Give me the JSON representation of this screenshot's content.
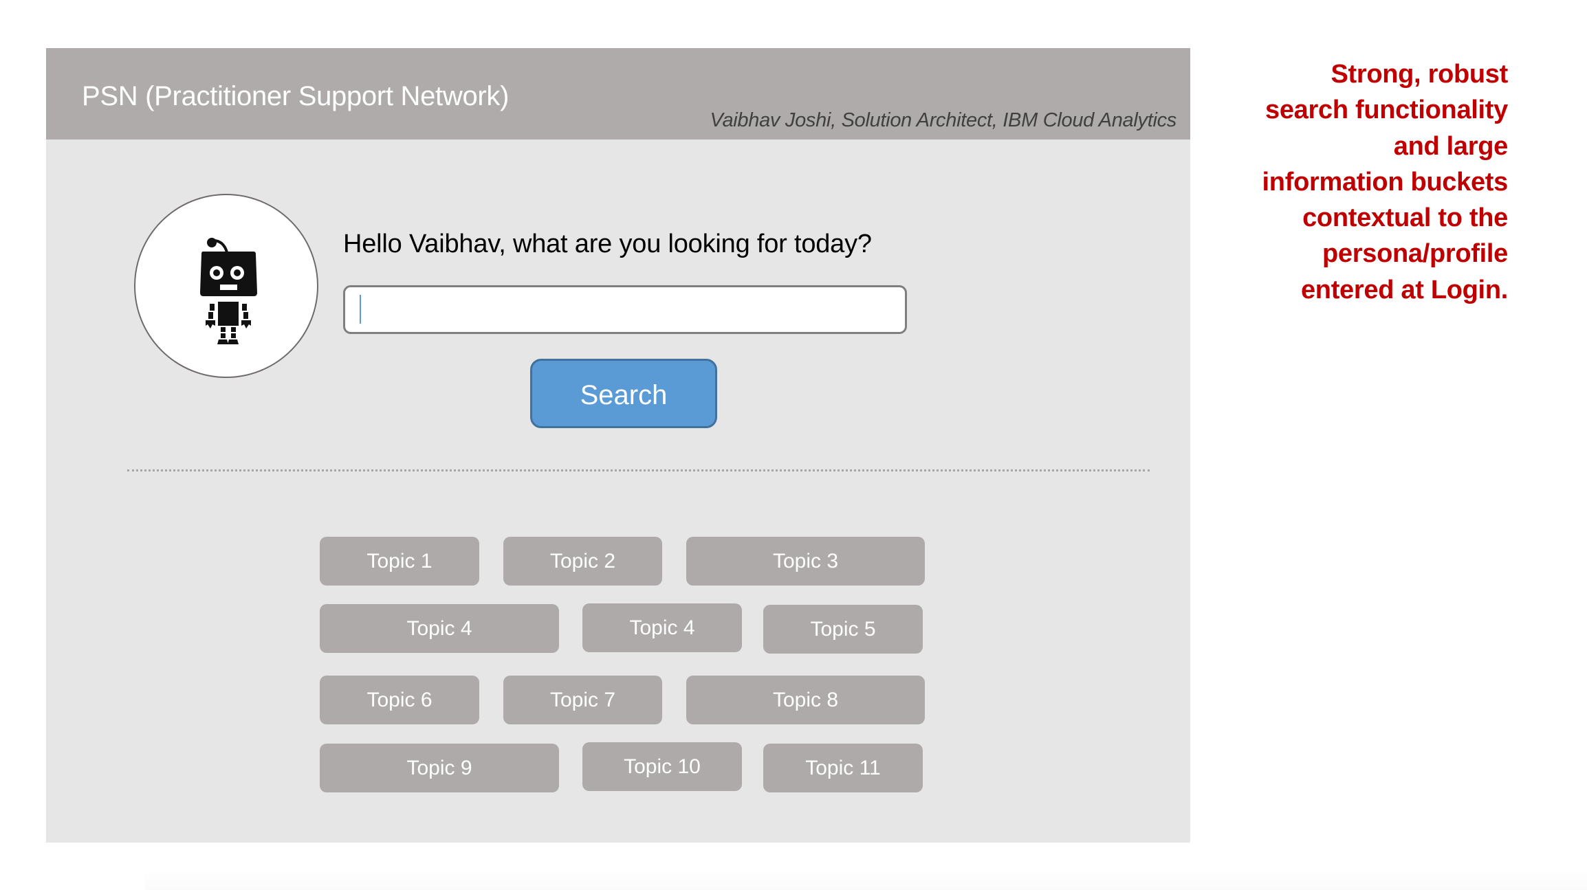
{
  "header": {
    "title": "PSN (Practitioner Support Network)",
    "subtitle": "Vaibhav Joshi, Solution Architect, IBM Cloud Analytics"
  },
  "avatar": {
    "icon": "robot-icon"
  },
  "search": {
    "greeting": "Hello Vaibhav, what are you looking for today?",
    "value": "",
    "placeholder": "",
    "button_label": "Search"
  },
  "topics": [
    {
      "label": "Topic 1"
    },
    {
      "label": "Topic 2"
    },
    {
      "label": "Topic 3"
    },
    {
      "label": "Topic 4"
    },
    {
      "label": "Topic 4"
    },
    {
      "label": "Topic 5"
    },
    {
      "label": "Topic 6"
    },
    {
      "label": "Topic 7"
    },
    {
      "label": "Topic 8"
    },
    {
      "label": "Topic 9"
    },
    {
      "label": "Topic 10"
    },
    {
      "label": "Topic 11"
    }
  ],
  "annotation": {
    "lines": [
      "Strong, robust",
      "search functionality",
      "and large",
      "information buckets",
      "contextual to the",
      "persona/profile",
      "entered at Login."
    ]
  },
  "colors": {
    "header_bg": "#afabaa",
    "panel_bg": "#e6e6e6",
    "accent": "#5b9bd5",
    "topic_bg": "#aeaaa9",
    "annotation": "#c00000"
  }
}
